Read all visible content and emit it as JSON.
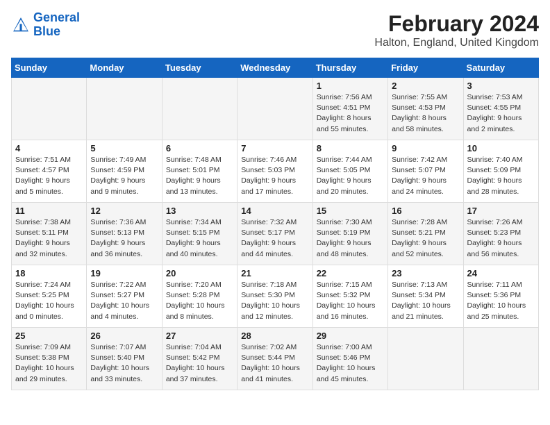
{
  "header": {
    "logo_line1": "General",
    "logo_line2": "Blue",
    "main_title": "February 2024",
    "subtitle": "Halton, England, United Kingdom"
  },
  "calendar": {
    "weekdays": [
      "Sunday",
      "Monday",
      "Tuesday",
      "Wednesday",
      "Thursday",
      "Friday",
      "Saturday"
    ],
    "weeks": [
      [
        {
          "day": "",
          "info": ""
        },
        {
          "day": "",
          "info": ""
        },
        {
          "day": "",
          "info": ""
        },
        {
          "day": "",
          "info": ""
        },
        {
          "day": "1",
          "info": "Sunrise: 7:56 AM\nSunset: 4:51 PM\nDaylight: 8 hours\nand 55 minutes."
        },
        {
          "day": "2",
          "info": "Sunrise: 7:55 AM\nSunset: 4:53 PM\nDaylight: 8 hours\nand 58 minutes."
        },
        {
          "day": "3",
          "info": "Sunrise: 7:53 AM\nSunset: 4:55 PM\nDaylight: 9 hours\nand 2 minutes."
        }
      ],
      [
        {
          "day": "4",
          "info": "Sunrise: 7:51 AM\nSunset: 4:57 PM\nDaylight: 9 hours\nand 5 minutes."
        },
        {
          "day": "5",
          "info": "Sunrise: 7:49 AM\nSunset: 4:59 PM\nDaylight: 9 hours\nand 9 minutes."
        },
        {
          "day": "6",
          "info": "Sunrise: 7:48 AM\nSunset: 5:01 PM\nDaylight: 9 hours\nand 13 minutes."
        },
        {
          "day": "7",
          "info": "Sunrise: 7:46 AM\nSunset: 5:03 PM\nDaylight: 9 hours\nand 17 minutes."
        },
        {
          "day": "8",
          "info": "Sunrise: 7:44 AM\nSunset: 5:05 PM\nDaylight: 9 hours\nand 20 minutes."
        },
        {
          "day": "9",
          "info": "Sunrise: 7:42 AM\nSunset: 5:07 PM\nDaylight: 9 hours\nand 24 minutes."
        },
        {
          "day": "10",
          "info": "Sunrise: 7:40 AM\nSunset: 5:09 PM\nDaylight: 9 hours\nand 28 minutes."
        }
      ],
      [
        {
          "day": "11",
          "info": "Sunrise: 7:38 AM\nSunset: 5:11 PM\nDaylight: 9 hours\nand 32 minutes."
        },
        {
          "day": "12",
          "info": "Sunrise: 7:36 AM\nSunset: 5:13 PM\nDaylight: 9 hours\nand 36 minutes."
        },
        {
          "day": "13",
          "info": "Sunrise: 7:34 AM\nSunset: 5:15 PM\nDaylight: 9 hours\nand 40 minutes."
        },
        {
          "day": "14",
          "info": "Sunrise: 7:32 AM\nSunset: 5:17 PM\nDaylight: 9 hours\nand 44 minutes."
        },
        {
          "day": "15",
          "info": "Sunrise: 7:30 AM\nSunset: 5:19 PM\nDaylight: 9 hours\nand 48 minutes."
        },
        {
          "day": "16",
          "info": "Sunrise: 7:28 AM\nSunset: 5:21 PM\nDaylight: 9 hours\nand 52 minutes."
        },
        {
          "day": "17",
          "info": "Sunrise: 7:26 AM\nSunset: 5:23 PM\nDaylight: 9 hours\nand 56 minutes."
        }
      ],
      [
        {
          "day": "18",
          "info": "Sunrise: 7:24 AM\nSunset: 5:25 PM\nDaylight: 10 hours\nand 0 minutes."
        },
        {
          "day": "19",
          "info": "Sunrise: 7:22 AM\nSunset: 5:27 PM\nDaylight: 10 hours\nand 4 minutes."
        },
        {
          "day": "20",
          "info": "Sunrise: 7:20 AM\nSunset: 5:28 PM\nDaylight: 10 hours\nand 8 minutes."
        },
        {
          "day": "21",
          "info": "Sunrise: 7:18 AM\nSunset: 5:30 PM\nDaylight: 10 hours\nand 12 minutes."
        },
        {
          "day": "22",
          "info": "Sunrise: 7:15 AM\nSunset: 5:32 PM\nDaylight: 10 hours\nand 16 minutes."
        },
        {
          "day": "23",
          "info": "Sunrise: 7:13 AM\nSunset: 5:34 PM\nDaylight: 10 hours\nand 21 minutes."
        },
        {
          "day": "24",
          "info": "Sunrise: 7:11 AM\nSunset: 5:36 PM\nDaylight: 10 hours\nand 25 minutes."
        }
      ],
      [
        {
          "day": "25",
          "info": "Sunrise: 7:09 AM\nSunset: 5:38 PM\nDaylight: 10 hours\nand 29 minutes."
        },
        {
          "day": "26",
          "info": "Sunrise: 7:07 AM\nSunset: 5:40 PM\nDaylight: 10 hours\nand 33 minutes."
        },
        {
          "day": "27",
          "info": "Sunrise: 7:04 AM\nSunset: 5:42 PM\nDaylight: 10 hours\nand 37 minutes."
        },
        {
          "day": "28",
          "info": "Sunrise: 7:02 AM\nSunset: 5:44 PM\nDaylight: 10 hours\nand 41 minutes."
        },
        {
          "day": "29",
          "info": "Sunrise: 7:00 AM\nSunset: 5:46 PM\nDaylight: 10 hours\nand 45 minutes."
        },
        {
          "day": "",
          "info": ""
        },
        {
          "day": "",
          "info": ""
        }
      ]
    ]
  }
}
